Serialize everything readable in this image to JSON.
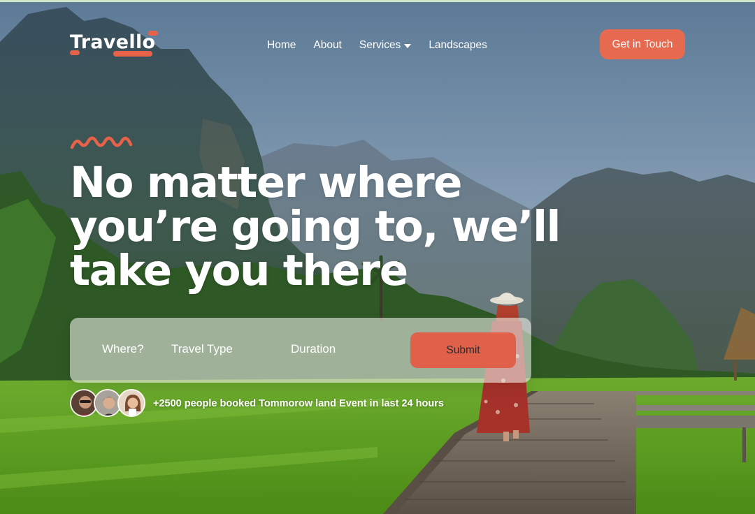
{
  "brand": {
    "name": "Travello",
    "accent_color": "#e66a50"
  },
  "nav": {
    "items": [
      {
        "label": "Home"
      },
      {
        "label": "About"
      },
      {
        "label": "Services",
        "has_dropdown": true
      },
      {
        "label": "Landscapes"
      }
    ],
    "cta_label": "Get in Touch"
  },
  "hero": {
    "headline": "No matter where you’re going to, we’ll take you there",
    "decoration_icon": "zigzag-icon"
  },
  "search": {
    "where_label": "Where?",
    "travel_type_label": "Travel Type",
    "duration_label": "Duration",
    "submit_label": "Submit"
  },
  "social_proof": {
    "text": "+2500 people booked Tommorow land Event in last 24 hours",
    "avatars": [
      "avatar-man-sunglasses",
      "avatar-man-curly-hair",
      "avatar-woman-coffee"
    ]
  }
}
